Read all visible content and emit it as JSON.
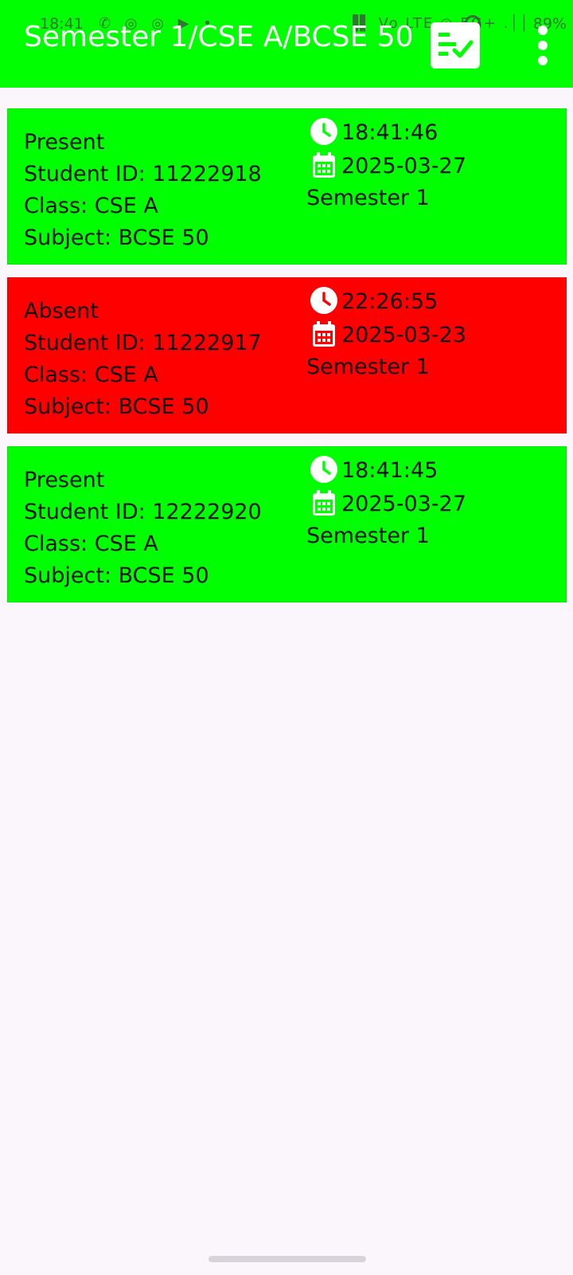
{
  "status_bar": {
    "time": "18:41",
    "left_icons": "✆ ◎ ◎ ▶ •",
    "right_icons": "▐▌ Vo LTE ◎ 5G+ .││",
    "battery": "89%"
  },
  "app_bar": {
    "title": "Semester 1/CSE A/BCSE 50",
    "checklist_icon": "checklist-icon",
    "menu_icon": "more-vert-icon"
  },
  "colors": {
    "app_bar": "#00ff00",
    "present": "#00ff00",
    "absent": "#ff0000",
    "background": "#fbf5fc"
  },
  "records": [
    {
      "status": "Present",
      "student_id": "Student ID: 11222918",
      "class": "Class: CSE A",
      "subject": "Subject: BCSE 50",
      "time": "18:41:46",
      "date": "2025-03-27",
      "semester": "Semester 1"
    },
    {
      "status": "Absent",
      "student_id": "Student ID: 11222917",
      "class": "Class: CSE A",
      "subject": "Subject: BCSE 50",
      "time": "22:26:55",
      "date": "2025-03-23",
      "semester": "Semester 1"
    },
    {
      "status": "Present",
      "student_id": "Student ID: 12222920",
      "class": "Class: CSE A",
      "subject": "Subject: BCSE 50",
      "time": "18:41:45",
      "date": "2025-03-27",
      "semester": "Semester 1"
    }
  ]
}
